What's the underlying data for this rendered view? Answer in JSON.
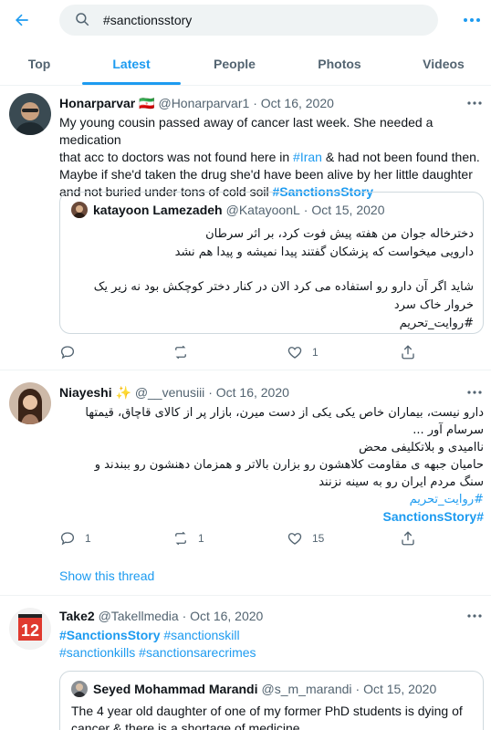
{
  "search": {
    "value": "#sanctionsstory"
  },
  "tabs": [
    "Top",
    "Latest",
    "People",
    "Photos",
    "Videos"
  ],
  "tweets": [
    {
      "name": "Honarparvar",
      "flag": "🇮🇷",
      "handle": "@Honarparvar1",
      "date": "· Oct 16, 2020",
      "text_line1": "My young cousin passed away of cancer last week. She needed a medication",
      "text_line2_a": "that acc to doctors was not found here in ",
      "text_line2_link": "#Iran",
      "text_line2_b": " & had not been found then.",
      "text_line3": "Maybe if she'd taken the drug she'd have been alive by her little daughter",
      "text_line4_a": "and not buried under tons of cold soil ",
      "text_line4_tag": "#SanctionsStory",
      "quote": {
        "name": "katayoon Lamezadeh",
        "handle": "@KatayoonL",
        "date": "· Oct 15, 2020",
        "line1": "دخترخاله جوان من هفته پیش فوت کرد، بر اثر سرطان",
        "line2": "دارویی میخواست که پزشکان گفتند پیدا نمیشه و پیدا هم نشد",
        "line3": "شاید اگر آن دارو رو استفاده می کرد الان در کنار دختر کوچکش بود نه زیر یک",
        "line4": "خروار خاک سرد",
        "line5": "#روایت_تحریم"
      },
      "likes": "1"
    },
    {
      "name": "Niayeshi",
      "handle": "@__venusiii",
      "date": "· Oct 16, 2020",
      "line1": "دارو نیست، بیماران خاص یکی یکی از دست میرن، بازار پر از کالای قاچاق، قیمتها",
      "line2": "سرسام آور ...",
      "line3": "ناامیدی و بلاتکلیفی محض",
      "line4": "حامیان جبهه ی مقاومت کلاهشون رو بزارن بالاتر و همزمان دهنشون رو ببندند و",
      "line5": "سنگ مردم ایران رو به سینه نزنند",
      "line6": "#روایت_تحریم",
      "line7": "#SanctionsStory",
      "replies": "1",
      "retweets": "1",
      "likes": "15"
    },
    {
      "name": "Take2",
      "handle": "@Takellmedia",
      "date": "· Oct 16, 2020",
      "tags1_a": "#SanctionsStory",
      "tags1_b": " #sanctionskill",
      "tags2": "#sanctionkills #sanctionsarecrimes",
      "quote": {
        "name": "Seyed Mohammad Marandi",
        "handle": "@s_m_marandi",
        "date": "· Oct 15, 2020",
        "line1": "The 4 year old daughter of one of my former PhD students is dying of",
        "line2": "cancer & there is a shortage of medicine."
      }
    }
  ],
  "show_thread": "Show this thread",
  "colors": {
    "accent": "#1d9bf0",
    "muted": "#536471",
    "text": "#0f1419",
    "border": "#eff3f4"
  }
}
